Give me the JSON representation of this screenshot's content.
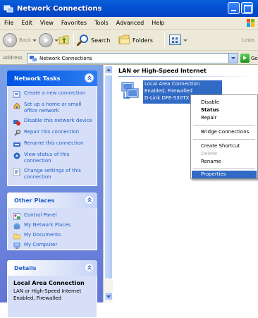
{
  "window": {
    "title": "Network Connections",
    "accent": "#0450d4"
  },
  "menubar": {
    "items": [
      "File",
      "Edit",
      "View",
      "Favorites",
      "Tools",
      "Advanced",
      "Help"
    ]
  },
  "toolbar": {
    "back_label": "Back",
    "search_label": "Search",
    "folders_label": "Folders",
    "links_label": "Links"
  },
  "address": {
    "label": "Address",
    "value": "Network Connections",
    "go_label": "Go"
  },
  "network_tasks": {
    "title": "Network Tasks",
    "items": [
      {
        "label": "Create a new connection",
        "icon": "new-connection-icon"
      },
      {
        "label": "Set up a home or small office network",
        "icon": "home-network-icon"
      },
      {
        "label": "Disable this network device",
        "icon": "disable-device-icon"
      },
      {
        "label": "Repair this connection",
        "icon": "repair-icon"
      },
      {
        "label": "Rename this connection",
        "icon": "rename-icon"
      },
      {
        "label": "View status of this connection",
        "icon": "status-icon"
      },
      {
        "label": "Change settings of this connection",
        "icon": "settings-icon"
      }
    ]
  },
  "other_places": {
    "title": "Other Places",
    "items": [
      {
        "label": "Control Panel",
        "icon": "control-panel-icon"
      },
      {
        "label": "My Network Places",
        "icon": "network-places-icon"
      },
      {
        "label": "My Documents",
        "icon": "documents-folder-icon"
      },
      {
        "label": "My Computer",
        "icon": "computer-icon"
      }
    ]
  },
  "details": {
    "title": "Details",
    "name": "Local Area Connection",
    "line1": "LAN or High-Speed Internet",
    "line2": "Enabled, Firewalled"
  },
  "content": {
    "group_header": "LAN or High-Speed Internet",
    "connection": {
      "name": "Local Area Connection",
      "status": "Enabled, Firewalled",
      "device": "D-Link DFE-530TX"
    }
  },
  "context_menu": {
    "groups": [
      [
        {
          "label": "Disable",
          "style": "normal"
        },
        {
          "label": "Status",
          "style": "bold"
        },
        {
          "label": "Repair",
          "style": "normal"
        }
      ],
      [
        {
          "label": "Bridge Connections",
          "style": "normal"
        }
      ],
      [
        {
          "label": "Create Shortcut",
          "style": "normal"
        },
        {
          "label": "Delete",
          "style": "disabled"
        },
        {
          "label": "Rename",
          "style": "normal"
        }
      ],
      [
        {
          "label": "Properties",
          "style": "highlight"
        }
      ]
    ]
  }
}
